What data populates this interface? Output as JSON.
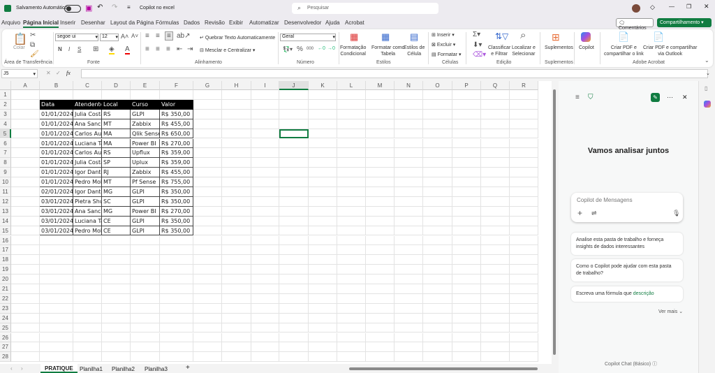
{
  "titlebar": {
    "autosave_label": "Salvamento Automático",
    "doc_title": "Copilot no excel",
    "search_placeholder": "Pesquisar"
  },
  "tabs": [
    "Arquivo",
    "Página Inicial",
    "Inserir",
    "Desenhar",
    "Layout da Página",
    "Fórmulas",
    "Dados",
    "Revisão",
    "Exibir",
    "Automatizar",
    "Desenvolvedor",
    "Ajuda",
    "Acrobat"
  ],
  "actions": {
    "comments": "Comentários",
    "share": "Compartilhamento"
  },
  "ribbon": {
    "paste": "Colar",
    "clipboard": "Área de Transferência",
    "font_name": "segoe ui",
    "font_size": "12",
    "bold": "N",
    "italic": "I",
    "underline": "S",
    "font_group": "Fonte",
    "wrap": "Quebrar Texto Automaticamente",
    "merge": "Mesclar e Centralizar",
    "align_group": "Alinhamento",
    "number_format": "Geral",
    "number_group": "Número",
    "cond_format": "Formatação\nCondicional",
    "format_table": "Formatar como\nTabela",
    "cell_styles": "Estilos de\nCélula",
    "styles_group": "Estilos",
    "insert": "Inserir",
    "delete": "Excluir",
    "format": "Formatar",
    "cells_group": "Células",
    "sort_filter": "Classificar\ne Filtrar",
    "find_select": "Localizar e\nSelecionar",
    "edit_group": "Edição",
    "addins": "Suplementos",
    "addins_group": "Suplementos",
    "copilot": "Copilot",
    "pdf_link": "Criar PDF e\ncompartilhar o link",
    "pdf_outlook": "Criar PDF e compartilhar\nvia Outlook",
    "acrobat_group": "Adobe Acrobat"
  },
  "formula_bar": {
    "name_box": "J5",
    "fx": "fx",
    "value": ""
  },
  "columns": [
    "A",
    "B",
    "C",
    "D",
    "E",
    "F",
    "G",
    "H",
    "I",
    "J",
    "K",
    "L",
    "M",
    "N",
    "O",
    "P",
    "Q",
    "R"
  ],
  "table": {
    "headers": [
      "Data",
      "Atendente",
      "Local",
      "Curso",
      "Valor"
    ],
    "rows": [
      [
        "01/01/2024",
        "Julia Costa",
        "RS",
        "GLPI",
        "R$ 350,00"
      ],
      [
        "01/01/2024",
        "Ana Sanch",
        "MT",
        "Zabbix",
        "R$ 455,00"
      ],
      [
        "01/01/2024",
        "Carlos Aug",
        "MA",
        "Qlik Sense",
        "R$ 650,00"
      ],
      [
        "01/01/2024",
        "Luciana Ta",
        "MA",
        "Power BI",
        "R$ 270,00"
      ],
      [
        "01/01/2024",
        "Carlos Aug",
        "RS",
        "Upflux",
        "R$ 359,00"
      ],
      [
        "01/01/2024",
        "Julia Costa",
        "SP",
        "Uplux",
        "R$ 359,00"
      ],
      [
        "01/01/2024",
        "Igor Danto",
        "RJ",
        "Zabbix",
        "R$ 455,00"
      ],
      [
        "01/01/2024",
        "Pedro Mol",
        "MT",
        "Pf Sense",
        "R$ 755,00"
      ],
      [
        "02/01/2024",
        "Igor Danto",
        "MG",
        "GLPI",
        "R$ 350,00"
      ],
      [
        "03/01/2024",
        "Pietra Shul",
        "SC",
        "GLPI",
        "R$ 350,00"
      ],
      [
        "03/01/2024",
        "Ana Sanch",
        "MG",
        "Power BI",
        "R$ 270,00"
      ],
      [
        "03/01/2024",
        "Luciana Ta",
        "CE",
        "GLPI",
        "R$ 350,00"
      ],
      [
        "03/01/2024",
        "Pedro Mol",
        "CE",
        "GLPI",
        "R$ 350,00"
      ]
    ]
  },
  "sheets": [
    "PRATIQUE",
    "Planilha1",
    "Planilha2",
    "Planilha3"
  ],
  "copilot": {
    "title": "Vamos analisar juntos",
    "input_placeholder": "Copilot de Mensagens",
    "suggestion1": "Analise esta pasta de trabalho e forneça insights de dados interessantes",
    "suggestion2": "Como o Copilot pode ajudar com esta pasta de trabalho?",
    "suggestion3_prefix": "Escreva uma fórmula que ",
    "suggestion3_highlight": "descrição",
    "see_more": "Ver mais",
    "footer": "Copilot Chat (Básico)"
  },
  "colors": {
    "accent": "#107c41",
    "header_fill": "#000000"
  }
}
